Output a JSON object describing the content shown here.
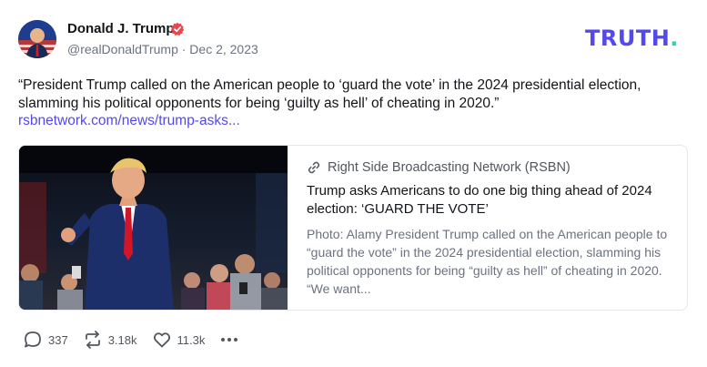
{
  "author": {
    "display_name": "Donald J. Trump",
    "handle_line": "@realDonaldTrump · Dec 2, 2023",
    "verified": true
  },
  "brand": {
    "word": "TRUTH",
    "dot": ".",
    "color": "#5448ee",
    "dot_color": "#2ed1b8"
  },
  "post": {
    "text": "“President Trump called on the American people to ‘guard the vote’ in the 2024 presidential election, slamming his political opponents for being ‘guilty as hell’ of cheating in 2020.”",
    "link": "rsbnetwork.com/news/trump-asks..."
  },
  "card": {
    "source": "Right Side Broadcasting Network (RSBN)",
    "title": "Trump asks Americans to do one big thing ahead of 2024 election: ‘GUARD THE VOTE’",
    "description": "Photo: Alamy President Trump called on the American people to “guard the vote” in the 2024 presidential election, slamming his political opponents for being “guilty as hell” of cheating in 2020. “We want..."
  },
  "actions": {
    "replies": "337",
    "retruths": "3.18k",
    "likes": "11.3k",
    "icons": [
      "reply-icon",
      "retruth-icon",
      "like-icon",
      "more-icon"
    ]
  }
}
